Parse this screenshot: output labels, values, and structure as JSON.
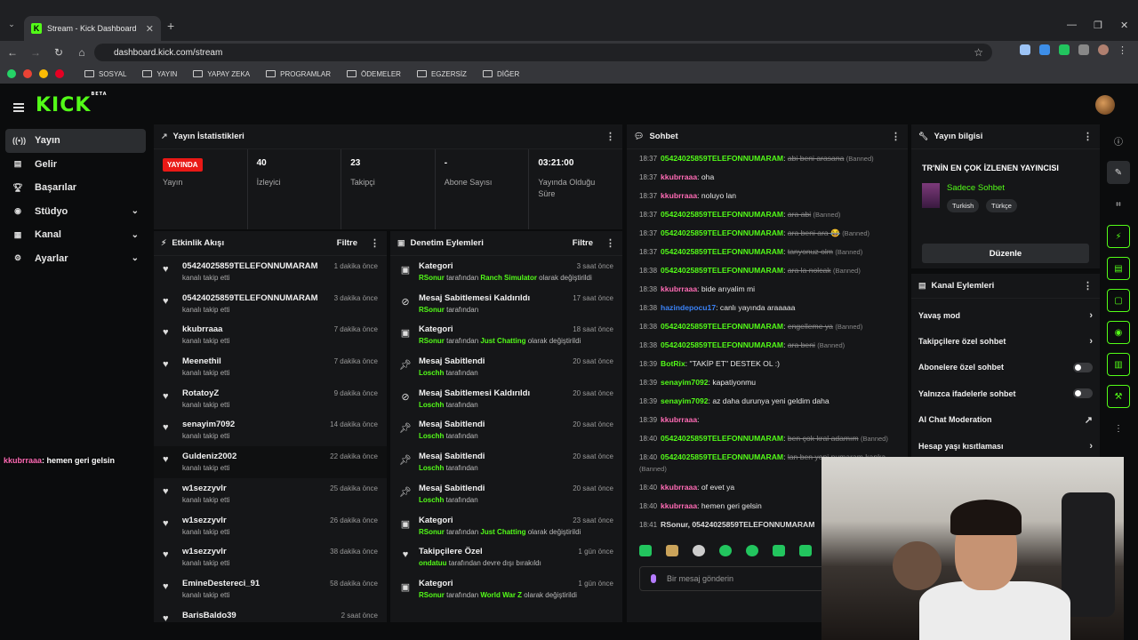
{
  "browser": {
    "tab_title": "Stream - Kick Dashboard",
    "url": "dashboard.kick.com/stream",
    "bookmarks": [
      "SOSYAL",
      "YAYIN",
      "YAPAY ZEKA",
      "PROGRAMLAR",
      "ÖDEMELER",
      "EGZERSİZ",
      "DİĞER"
    ]
  },
  "brand": {
    "logo": "KICK",
    "badge": "BETA",
    "accent": "#53fc18"
  },
  "sidebar": {
    "items": [
      {
        "label": "Yayın",
        "icon": "broadcast-icon"
      },
      {
        "label": "Gelir",
        "icon": "money-icon"
      },
      {
        "label": "Başarılar",
        "icon": "trophy-icon"
      },
      {
        "label": "Stüdyo",
        "icon": "studio-icon"
      },
      {
        "label": "Kanal",
        "icon": "channel-icon"
      },
      {
        "label": "Ayarlar",
        "icon": "gear-icon"
      }
    ]
  },
  "overlay_chat": {
    "user": "kkubrraaa",
    "text": ": hemen geri gelsin"
  },
  "stats": {
    "title": "Yayın İstatistikleri",
    "live_label": "YAYINDA",
    "live_sub": "Yayın",
    "cells": [
      {
        "value": "40",
        "label": "İzleyici"
      },
      {
        "value": "23",
        "label": "Takipçi"
      },
      {
        "value": "-",
        "label": "Abone Sayısı"
      },
      {
        "value": "03:21:00",
        "label": "Yayında Olduğu Süre"
      }
    ]
  },
  "activity": {
    "title": "Etkinlik Akışı",
    "filter": "Filtre",
    "rows": [
      {
        "name": "05424025859TELEFONNUMARAM",
        "sub": "kanalı takip etti",
        "time": "1 dakika önce"
      },
      {
        "name": "05424025859TELEFONNUMARAM",
        "sub": "kanalı takip etti",
        "time": "3 dakika önce"
      },
      {
        "name": "kkubrraaa",
        "sub": "kanalı takip etti",
        "time": "7 dakika önce"
      },
      {
        "name": "Meenethil",
        "sub": "kanalı takip etti",
        "time": "7 dakika önce"
      },
      {
        "name": "RotatoyZ",
        "sub": "kanalı takip etti",
        "time": "9 dakika önce"
      },
      {
        "name": "senayim7092",
        "sub": "kanalı takip etti",
        "time": "14 dakika önce"
      },
      {
        "name": "Guldeniz2002",
        "sub": "kanalı takip etti",
        "time": "22 dakika önce"
      },
      {
        "name": "w1sezzyvlr",
        "sub": "kanalı takip etti",
        "time": "25 dakika önce"
      },
      {
        "name": "w1sezzyvlr",
        "sub": "kanalı takip etti",
        "time": "26 dakika önce"
      },
      {
        "name": "w1sezzyvlr",
        "sub": "kanalı takip etti",
        "time": "38 dakika önce"
      },
      {
        "name": "EmineDestereci_91",
        "sub": "kanalı takip etti",
        "time": "58 dakika önce"
      },
      {
        "name": "BarisBaldo39",
        "sub": "",
        "time": "2 saat önce"
      }
    ]
  },
  "moderation": {
    "title": "Denetim Eylemleri",
    "filter": "Filtre",
    "rows": [
      {
        "icon": "category-icon",
        "name": "Kategori",
        "user": "RSonur",
        "mid": " tarafından ",
        "hl": "Ranch Simulator",
        "end": " olarak değiştirildi",
        "time": "3 saat önce"
      },
      {
        "icon": "unpin-icon",
        "name": "Mesaj Sabitlemesi Kaldırıldı",
        "user": "RSonur",
        "mid": " tarafından",
        "hl": "",
        "end": "",
        "time": "17 saat önce"
      },
      {
        "icon": "category-icon",
        "name": "Kategori",
        "user": "RSonur",
        "mid": " tarafından ",
        "hl": "Just Chatting",
        "end": " olarak değiştirildi",
        "time": "18 saat önce"
      },
      {
        "icon": "pin-icon",
        "name": "Mesaj Sabitlendi",
        "user": "Loschh",
        "mid": " tarafından",
        "hl": "",
        "end": "",
        "time": "20 saat önce"
      },
      {
        "icon": "unpin-icon",
        "name": "Mesaj Sabitlemesi Kaldırıldı",
        "user": "Loschh",
        "mid": " tarafından",
        "hl": "",
        "end": "",
        "time": "20 saat önce"
      },
      {
        "icon": "pin-icon",
        "name": "Mesaj Sabitlendi",
        "user": "Loschh",
        "mid": " tarafından",
        "hl": "",
        "end": "",
        "time": "20 saat önce"
      },
      {
        "icon": "pin-icon",
        "name": "Mesaj Sabitlendi",
        "user": "Loschh",
        "mid": " tarafından",
        "hl": "",
        "end": "",
        "time": "20 saat önce"
      },
      {
        "icon": "pin-icon",
        "name": "Mesaj Sabitlendi",
        "user": "Loschh",
        "mid": " tarafından",
        "hl": "",
        "end": "",
        "time": "20 saat önce"
      },
      {
        "icon": "category-icon",
        "name": "Kategori",
        "user": "RSonur",
        "mid": " tarafından ",
        "hl": "Just Chatting",
        "end": " olarak değiştirildi",
        "time": "23 saat önce"
      },
      {
        "icon": "heart-icon",
        "name": "Takipçilere Özel",
        "user": "ondatuu",
        "mid": " tarafından devre dışı bırakıldı",
        "hl": "",
        "end": "",
        "time": "1 gün önce"
      },
      {
        "icon": "category-icon",
        "name": "Kategori",
        "user": "RSonur",
        "mid": " tarafından ",
        "hl": "World War Z",
        "end": " olarak değiştirildi",
        "time": "1 gün önce"
      }
    ]
  },
  "chat": {
    "title": "Sohbet",
    "placeholder": "Bir mesaj gönderin",
    "messages": [
      {
        "time": "18:37",
        "user": "05424025859TELEFONNUMARAM",
        "color": "#53fc18",
        "text": "abi beni arasana",
        "deleted": true,
        "banned": "(Banned)"
      },
      {
        "time": "18:37",
        "user": "kkubrraaa",
        "color": "#ff6bb5",
        "text": "oha",
        "deleted": false,
        "banned": ""
      },
      {
        "time": "18:37",
        "user": "kkubrraaa",
        "color": "#ff6bb5",
        "text": "noluyo lan",
        "deleted": false,
        "banned": ""
      },
      {
        "time": "18:37",
        "user": "05424025859TELEFONNUMARAM",
        "color": "#53fc18",
        "text": "ara abi",
        "deleted": true,
        "banned": "(Banned)"
      },
      {
        "time": "18:37",
        "user": "05424025859TELEFONNUMARAM",
        "color": "#53fc18",
        "text": "ara beni ara 😂",
        "deleted": true,
        "banned": "(Banned)"
      },
      {
        "time": "18:37",
        "user": "05424025859TELEFONNUMARAM",
        "color": "#53fc18",
        "text": "tanyonuz olm",
        "deleted": true,
        "banned": "(Banned)"
      },
      {
        "time": "18:38",
        "user": "05424025859TELEFONNUMARAM",
        "color": "#53fc18",
        "text": "ara la nolcak",
        "deleted": true,
        "banned": "(Banned)"
      },
      {
        "time": "18:38",
        "user": "kkubrraaa",
        "color": "#ff6bb5",
        "text": "bide arıyalim mi",
        "deleted": false,
        "banned": ""
      },
      {
        "time": "18:38",
        "user": "hazindepocu17",
        "color": "#3b82f6",
        "text": "canlı yayında araaaaa",
        "deleted": false,
        "banned": ""
      },
      {
        "time": "18:38",
        "user": "05424025859TELEFONNUMARAM",
        "color": "#53fc18",
        "text": "engelleme ya",
        "deleted": true,
        "banned": "(Banned)"
      },
      {
        "time": "18:38",
        "user": "05424025859TELEFONNUMARAM",
        "color": "#53fc18",
        "text": "ara beni",
        "deleted": true,
        "banned": "(Banned)"
      },
      {
        "time": "18:39",
        "user": "BotRix",
        "color": "#53fc18",
        "text": "\"TAKİP ET\" DESTEK OL :)",
        "deleted": false,
        "banned": ""
      },
      {
        "time": "18:39",
        "user": "senayim7092",
        "color": "#53fc18",
        "text": "kapatiyonmu",
        "deleted": false,
        "banned": ""
      },
      {
        "time": "18:39",
        "user": "senayim7092",
        "color": "#53fc18",
        "text": "az daha durunya yeni geldim daha",
        "deleted": false,
        "banned": ""
      },
      {
        "time": "18:39",
        "user": "kkubrraaa",
        "color": "#ff6bb5",
        "text": "",
        "deleted": false,
        "banned": ""
      },
      {
        "time": "18:40",
        "user": "05424025859TELEFONNUMARAM",
        "color": "#53fc18",
        "text": "ben çok kral adamım",
        "deleted": true,
        "banned": "(Banned)"
      },
      {
        "time": "18:40",
        "user": "05424025859TELEFONNUMARAM",
        "color": "#53fc18",
        "text": "lan ben yeni numaram kanka",
        "deleted": true,
        "banned": "(Banned)"
      },
      {
        "time": "18:40",
        "user": "kkubrraaa",
        "color": "#ff6bb5",
        "text": "of evet ya",
        "deleted": false,
        "banned": ""
      },
      {
        "time": "18:40",
        "user": "kkubrraaa",
        "color": "#ff6bb5",
        "text": "hemen geri gelsin",
        "deleted": false,
        "banned": ""
      },
      {
        "time": "18:41",
        "user": "RSonur, 05424025859TELEFONNUMARAM",
        "color": "#dddddd",
        "text": "",
        "deleted": false,
        "banned": ""
      }
    ]
  },
  "stream_info": {
    "title": "Yayın bilgisi",
    "stream_title": "TR'NİN EN ÇOK İZLENEN YAYINCISI",
    "category": "Sadece Sohbet",
    "tags": [
      "Turkish",
      "Türkçe"
    ],
    "edit_label": "Düzenle"
  },
  "channel_actions": {
    "title": "Kanal Eylemleri",
    "rows": [
      {
        "label": "Yavaş mod",
        "kind": "chevron"
      },
      {
        "label": "Takipçilere özel sohbet",
        "kind": "chevron"
      },
      {
        "label": "Abonelere özel sohbet",
        "kind": "toggle"
      },
      {
        "label": "Yalnızca ifadelerle sohbet",
        "kind": "toggle"
      },
      {
        "label": "AI Chat Moderation",
        "kind": "external"
      },
      {
        "label": "Hesap yaşı kısıtlaması",
        "kind": "chevron"
      }
    ]
  }
}
